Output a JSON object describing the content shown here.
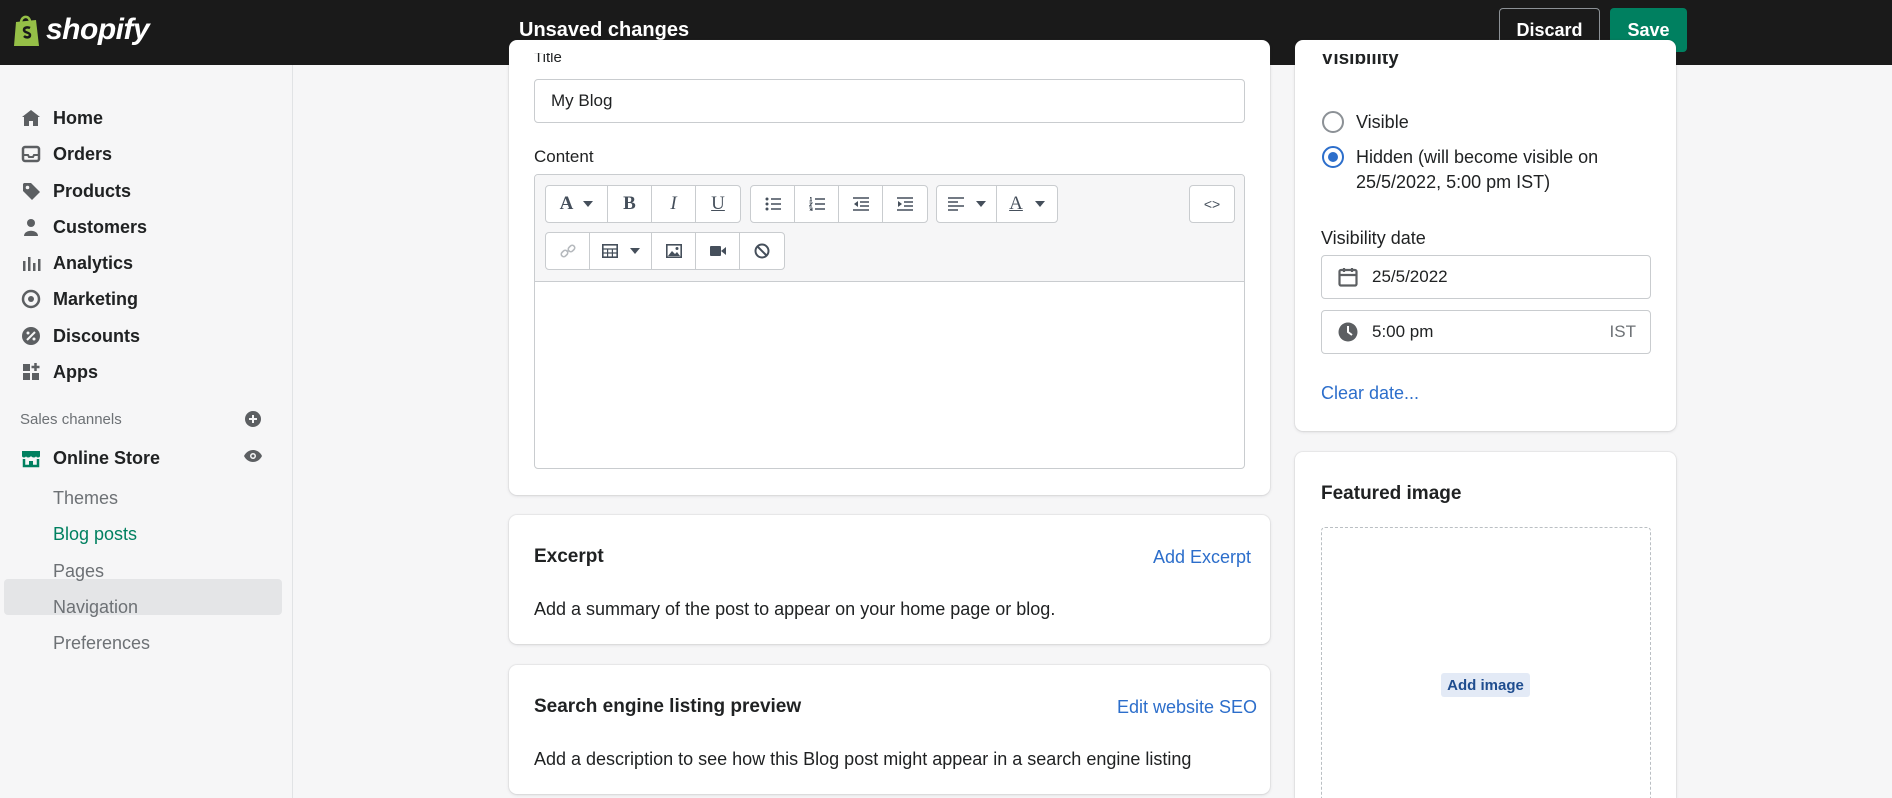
{
  "topbar": {
    "brand": "shopify",
    "status": "Unsaved changes",
    "discard_label": "Discard",
    "save_label": "Save"
  },
  "sidebar": {
    "items": [
      {
        "label": "Home",
        "icon": "home-icon"
      },
      {
        "label": "Orders",
        "icon": "inbox-icon"
      },
      {
        "label": "Products",
        "icon": "tag-icon"
      },
      {
        "label": "Customers",
        "icon": "person-icon"
      },
      {
        "label": "Analytics",
        "icon": "bar-chart-icon"
      },
      {
        "label": "Marketing",
        "icon": "target-icon"
      },
      {
        "label": "Discounts",
        "icon": "discount-icon"
      },
      {
        "label": "Apps",
        "icon": "apps-icon"
      }
    ],
    "sales_channels_label": "Sales channels",
    "online_store_label": "Online Store",
    "sub_items": [
      "Themes",
      "Blog posts",
      "Pages",
      "Navigation",
      "Preferences"
    ],
    "active_sub_item": "Blog posts"
  },
  "post": {
    "title_label": "Title",
    "title_value": "My Blog",
    "content_label": "Content",
    "html_toggle": "<>"
  },
  "excerpt": {
    "title": "Excerpt",
    "action": "Add Excerpt",
    "description": "Add a summary of the post to appear on your home page or blog."
  },
  "seo": {
    "title": "Search engine listing preview",
    "action": "Edit website SEO",
    "description": "Add a description to see how this Blog post might appear in a search engine listing"
  },
  "visibility": {
    "title": "Visibility",
    "options": [
      "Visible",
      "Hidden (will become visible on",
      "25/5/2022, 5:00 pm IST)"
    ],
    "selected": "Hidden",
    "date_label": "Visibility date",
    "date_value": "25/5/2022",
    "time_value": "5:00 pm",
    "timezone": "IST",
    "clear_link": "Clear date..."
  },
  "featured_image": {
    "title": "Featured image",
    "button": "Add image"
  },
  "colors": {
    "topbar": "#1a1a1a",
    "primary": "#008060",
    "link": "#2c6ecb"
  }
}
